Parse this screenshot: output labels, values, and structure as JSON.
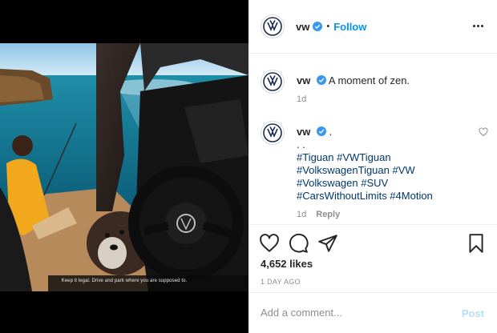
{
  "media": {
    "overlay_text": "Keep it legal. Drive and park where you are supposed to."
  },
  "post_header": {
    "username": "vw",
    "separator": "•",
    "follow_label": "Follow",
    "more_icon": "more-options-icon"
  },
  "comments": [
    {
      "username": "vw",
      "text": "A moment of zen.",
      "time": "1d"
    },
    {
      "username": "vw",
      "text": ".",
      "extra_line": ". .",
      "hashtags": [
        "#Tiguan #VWTiguan",
        "#VolkswagenTiguan #VW",
        "#Volkswagen #SUV",
        "#CarsWithoutLimits #4Motion"
      ],
      "time": "1d",
      "reply_label": "Reply"
    }
  ],
  "actions": {
    "likes": "4,652 likes",
    "time_ago": "1 DAY AGO"
  },
  "add_comment": {
    "placeholder": "Add a comment...",
    "post_label": "Post"
  },
  "colors": {
    "accent": "#0095f6",
    "verified": "#3897f0",
    "hashtag": "#00376b",
    "muted": "#8e8e8e"
  }
}
